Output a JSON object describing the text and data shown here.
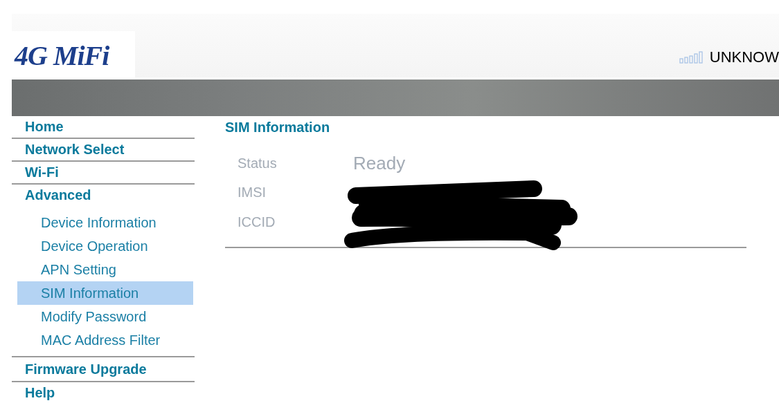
{
  "header": {
    "logo": "4G MiFi",
    "network": "UNKNOW"
  },
  "sidebar": {
    "items": [
      {
        "label": "Home",
        "selected": false
      },
      {
        "label": "Network Select",
        "selected": false
      },
      {
        "label": "Wi-Fi",
        "selected": false
      },
      {
        "label": "Advanced",
        "selected": false,
        "children": [
          {
            "label": "Device Information",
            "selected": false
          },
          {
            "label": "Device Operation",
            "selected": false
          },
          {
            "label": "APN Setting",
            "selected": false
          },
          {
            "label": "SIM Information",
            "selected": true
          },
          {
            "label": "Modify Password",
            "selected": false
          },
          {
            "label": "MAC Address Filter",
            "selected": false
          }
        ]
      },
      {
        "label": "Firmware Upgrade",
        "selected": false
      },
      {
        "label": "Help",
        "selected": false
      }
    ]
  },
  "content": {
    "title": "SIM Information",
    "rows": [
      {
        "label": "Status",
        "value": "Ready"
      },
      {
        "label": "IMSI"
      },
      {
        "label": "ICCID"
      }
    ]
  }
}
